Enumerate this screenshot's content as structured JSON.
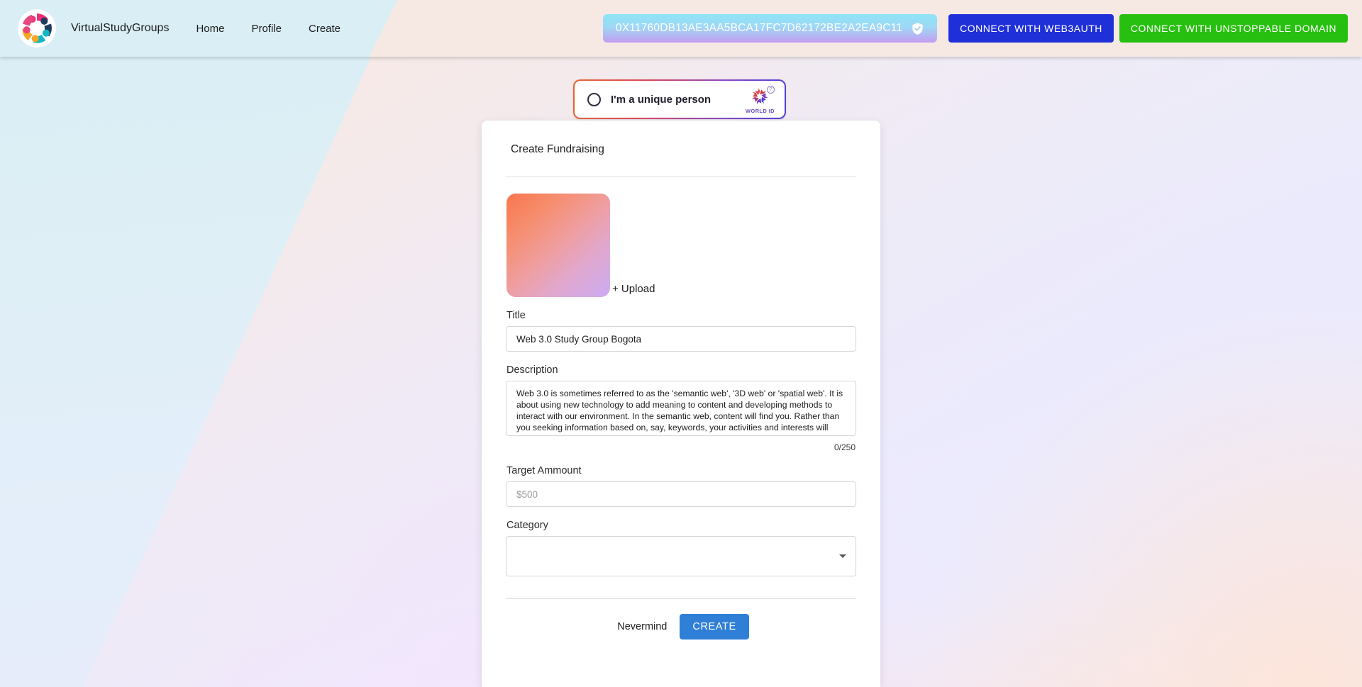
{
  "navbar": {
    "logo_icon": "study-groups-circle-logo",
    "brand": "VirtualStudyGroups",
    "links": [
      {
        "label": "Home",
        "name": "home"
      },
      {
        "label": "Profile",
        "name": "profile"
      },
      {
        "label": "Create",
        "name": "create"
      }
    ],
    "wallet": {
      "address": "0X11760DB13AE3AA5BCA17FC7D62172BE2A2EA9C11",
      "badge_icon": "verified-shield-check-icon",
      "gradient_from": "#8ee4f5",
      "gradient_to": "#c49cf0"
    },
    "web3auth_button": "CONNECT WITH WEB3AUTH",
    "web3auth_color": "#2030d8",
    "unstoppable_button": "CONNECT WITH UNSTOPPABLE DOMAIN",
    "unstoppable_color": "#28c010"
  },
  "worldid": {
    "radio_icon": "radio-unchecked-icon",
    "label": "I'm a unique person",
    "logo_icon": "world-id-starburst-icon",
    "logo_text": "WORLD ID",
    "help_icon": "question-mark-icon",
    "help_glyph": "?",
    "border_gradient_from": "#e8642e",
    "border_gradient_to": "#4b3fd8"
  },
  "card": {
    "title": "Create Fundraising",
    "upload": {
      "label": "+ Upload",
      "preview_gradient_from": "#f8764e",
      "preview_gradient_to": "#cbabf2"
    },
    "title_field": {
      "label": "Title",
      "value": "Web 3.0 Study Group Bogota",
      "placeholder": ""
    },
    "description_field": {
      "label": "Description",
      "value": "Web 3.0 is sometimes referred to as the 'semantic web', '3D web' or 'spatial web'. It is about using new technology to add meaning to content and developing methods to interact with our environment. In the semantic web, content will find you. Rather than you seeking information based on, say, keywords, your activities and interests will determine how information finds you and the format you need,",
      "char_count": "0/250"
    },
    "amount_field": {
      "label": "Target Ammount",
      "value": "",
      "placeholder": "$500"
    },
    "category_field": {
      "label": "Category",
      "value": "",
      "caret_icon": "chevron-down-icon"
    },
    "cancel_button": "Nevermind",
    "create_button": "CREATE",
    "create_button_color": "#2f7fd6"
  }
}
